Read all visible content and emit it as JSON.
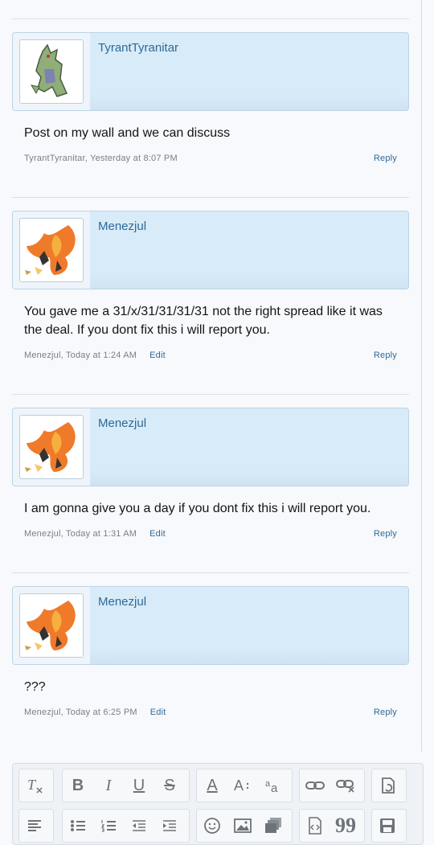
{
  "messages": [
    {
      "username": "TyrantTyranitar",
      "avatar_icon": "tyranitar-icon",
      "body": "Post on my wall and we can discuss",
      "meta": "TyrantTyranitar, Yesterday at 8:07 PM",
      "edit_label": "",
      "reply_label": "Reply"
    },
    {
      "username": "Menezjul",
      "avatar_icon": "charizard-icon",
      "body": "You gave me a 31/x/31/31/31/31 not the right spread like it was the deal. If you dont fix this i will report you.",
      "meta": "Menezjul, Today at 1:24 AM",
      "edit_label": "Edit",
      "reply_label": "Reply"
    },
    {
      "username": "Menezjul",
      "avatar_icon": "charizard-icon",
      "body": "I am gonna give you a day if you dont fix this i will report you.",
      "meta": "Menezjul, Today at 1:31 AM",
      "edit_label": "Edit",
      "reply_label": "Reply"
    },
    {
      "username": "Menezjul",
      "avatar_icon": "charizard-icon",
      "body": "???",
      "meta": "Menezjul, Today at 6:25 PM",
      "edit_label": "Edit",
      "reply_label": "Reply"
    }
  ],
  "toolbar": {
    "row1": [
      "clear-formatting-icon",
      "bold-icon",
      "italic-icon",
      "underline-icon",
      "strikethrough-icon",
      "text-color-icon",
      "font-size-icon",
      "font-family-icon",
      "link-icon",
      "unlink-icon",
      "undo-icon"
    ],
    "row2": [
      "align-icon",
      "bullet-list-icon",
      "numbered-list-icon",
      "outdent-icon",
      "indent-icon",
      "smilie-icon",
      "image-icon",
      "media-icon",
      "code-icon",
      "quote-icon",
      "save-draft-icon"
    ],
    "glyphs": {
      "bold": "B",
      "italic": "I",
      "underline": "U",
      "strike": "S",
      "color": "A",
      "fontsize": "A",
      "quote": "99"
    }
  }
}
